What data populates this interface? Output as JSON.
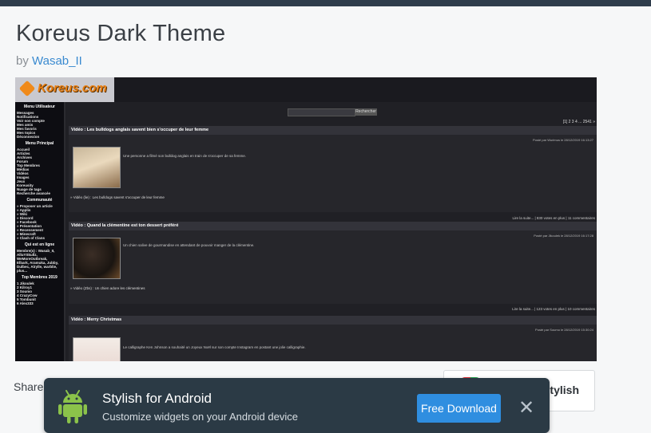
{
  "page": {
    "title": "Koreus Dark Theme",
    "by_prefix": "by",
    "author": "Wasab_II"
  },
  "screenshot": {
    "logo_text": "Koreus.com",
    "sidebar": [
      {
        "heading": "Menu Utilisateur",
        "items": [
          "Messages",
          "Notifications",
          "Voir son compte",
          "Mes amis",
          "Mes favoris",
          "Mes topics",
          "Déconnexion"
        ]
      },
      {
        "heading": "Menu Principal",
        "items": [
          "Accueil",
          "Articles",
          "Archives",
          "Forum",
          "Top Membres",
          "Médias",
          "Vidéos",
          "Images",
          "Jeux",
          "Koreusity",
          "Nuage de tags",
          "Recherche avancée"
        ]
      },
      {
        "heading": "Communauté",
        "items": [
          "» Proposer un article",
          "» Applis",
          "» Wiki",
          "» Discord",
          "» Facebook",
          "» Présentation",
          "» Recensement",
          "» Minecraft",
          "» Clash of Clans"
        ]
      },
      {
        "heading": "Qui est en ligne",
        "items": [
          "Membre(s) : Wasab_II,",
          "AlluYSkullz,",
          "WeMoreOutbreak,",
          "Elbark, Aramuka, Jubby,",
          "Dulbec, Alrylle, warblie,",
          "plus..."
        ]
      },
      {
        "heading": "Top Membres 2019",
        "items": [
          "1  Jikoulek",
          "2  Kilroy1",
          "3  Soumo",
          "4  CrazyCow",
          "5  Tombunit",
          "6  Alex333"
        ]
      }
    ],
    "search_button": "Rechercher",
    "pager": "[1] 2 3 4 ... 2541 »",
    "posts": [
      {
        "title": "Vidéo : Les bulldogs anglais savent bien s'occuper de leur femme",
        "meta": "Posté par Wurlmus le 28/12/2019 16:13:27",
        "text": "Une personne a filmé son bulldog anglais en train de s'occuper de sa femme.",
        "video": "» Vidéo (lie) : Les bulldogs savent s'occuper de leur femme",
        "footer": "Lire la suite... | 830 votes en plus | 11 commentaires"
      },
      {
        "title": "Vidéo : Quand la clémentine est ton dessert préféré",
        "meta": "Posté par Jikoulek le 28/12/2019 16:17:28",
        "text": "Un chien salive de gourmandise en attendant de pouvoir manger de la clémentine.",
        "video": "» Vidéo (Zbs) : Un chien adore les clémentines",
        "footer": "Lire la suite... | 123 votes en plus | 10 commentaires"
      },
      {
        "title": "Vidéo : Merry Christmas",
        "meta": "Posté par Soumo le 28/12/2019 15:30:24",
        "text": "Le calligraphe Ken Johnson a souhaité un Joyeux Noël sur son compte Instagram en postant une jolie calligraphie.",
        "video": "",
        "footer": ""
      }
    ]
  },
  "share_label": "Share",
  "install_label": "Stylish",
  "toast": {
    "title": "Stylish for Android",
    "subtitle": "Customize widgets on your Android device",
    "button": "Free Download"
  },
  "colors": {
    "topbar": "#2f3d4c",
    "link": "#3a8ad0",
    "toast_bg": "#2b3a45",
    "download_button": "#2f8ee0",
    "android_green": "#8bc34a"
  },
  "icons": [
    "android-icon",
    "close-icon",
    "stylish-logo-icon"
  ]
}
